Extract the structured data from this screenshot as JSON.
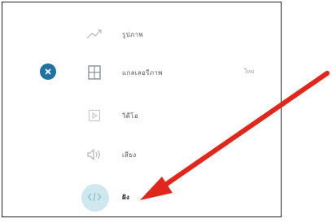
{
  "menu": {
    "close_icon": "close-icon",
    "items": [
      {
        "label": "รูปภาพ",
        "icon": "image-icon"
      },
      {
        "label": "แกลเลอรีภาพ",
        "icon": "gallery-icon"
      },
      {
        "label": "วิดีโอ",
        "icon": "video-icon"
      },
      {
        "label": "เสียง",
        "icon": "audio-icon"
      },
      {
        "label": "ฝัง",
        "icon": "embed-icon"
      }
    ],
    "side_label": "ใหม่"
  },
  "annotation": {
    "arrow_color": "#e1261c",
    "highlight_color": "#cfe8ef",
    "accent": "#1e73a3"
  }
}
